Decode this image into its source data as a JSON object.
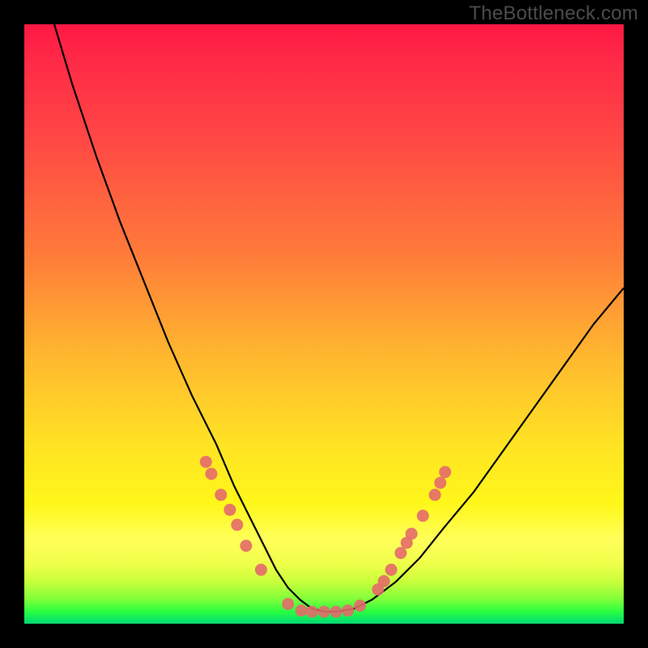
{
  "watermark": "TheBottleneck.com",
  "chart_data": {
    "type": "line",
    "title": "",
    "xlabel": "",
    "ylabel": "",
    "xlim": [
      0,
      100
    ],
    "ylim": [
      0,
      100
    ],
    "grid": false,
    "legend": false,
    "series": [
      {
        "name": "curve",
        "x": [
          5,
          8,
          12,
          16,
          20,
          24,
          28,
          32,
          35,
          38,
          40,
          42,
          44,
          46,
          48,
          50,
          52,
          55,
          58,
          62,
          66,
          70,
          75,
          80,
          85,
          90,
          95,
          100
        ],
        "y": [
          100,
          90,
          78,
          67,
          57,
          47,
          38,
          30,
          23,
          17,
          13,
          9,
          6,
          4,
          2.5,
          2,
          2,
          2.5,
          4,
          7,
          11,
          16,
          22,
          29,
          36,
          43,
          50,
          56
        ]
      }
    ],
    "markers": [
      {
        "x": 30.3,
        "y": 27
      },
      {
        "x": 31.2,
        "y": 25
      },
      {
        "x": 32.8,
        "y": 21.5
      },
      {
        "x": 34.3,
        "y": 19
      },
      {
        "x": 35.5,
        "y": 16.5
      },
      {
        "x": 37.0,
        "y": 13
      },
      {
        "x": 39.5,
        "y": 9
      },
      {
        "x": 44.0,
        "y": 3.3
      },
      {
        "x": 46.2,
        "y": 2.2
      },
      {
        "x": 48.0,
        "y": 2.0
      },
      {
        "x": 50.0,
        "y": 2.0
      },
      {
        "x": 52.0,
        "y": 2.0
      },
      {
        "x": 54.0,
        "y": 2.2
      },
      {
        "x": 56.0,
        "y": 3.0
      },
      {
        "x": 59.0,
        "y": 5.7
      },
      {
        "x": 60.0,
        "y": 7.1
      },
      {
        "x": 61.2,
        "y": 9.0
      },
      {
        "x": 62.8,
        "y": 11.8
      },
      {
        "x": 63.8,
        "y": 13.5
      },
      {
        "x": 64.6,
        "y": 15.0
      },
      {
        "x": 66.5,
        "y": 18.0
      },
      {
        "x": 68.5,
        "y": 21.5
      },
      {
        "x": 69.4,
        "y": 23.5
      },
      {
        "x": 70.2,
        "y": 25.3
      }
    ],
    "marker_color": "#e46a6a",
    "curve_color": "#000000",
    "gradient_stops": [
      {
        "pos": 0,
        "color": "#ff1844"
      },
      {
        "pos": 50,
        "color": "#ffb62f"
      },
      {
        "pos": 80,
        "color": "#fff71a"
      },
      {
        "pos": 100,
        "color": "#07d570"
      }
    ]
  }
}
